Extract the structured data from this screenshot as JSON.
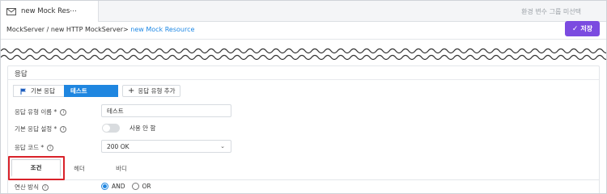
{
  "tab": {
    "title": "new Mock Res⋯",
    "icon": "mail-icon"
  },
  "env_select": {
    "placeholder": "환경 변수 그룹 미선택"
  },
  "breadcrumb": {
    "path": "MockServer / new HTTP MockServer>",
    "active": " new Mock Resource"
  },
  "toolbar": {
    "save_label": "저장"
  },
  "panel": {
    "title": "응답"
  },
  "response_types": {
    "default_label": "기본 응답",
    "current_label": "테스트",
    "add_label": "응답 유형 추가"
  },
  "fields": {
    "type_name": {
      "label": "응답 유형 이름 *",
      "value": "테스트"
    },
    "default_setting": {
      "label": "기본 응답 설정 *",
      "value": "사용 안 함",
      "enabled": false
    },
    "response_code": {
      "label": "응답 코드 *",
      "value": "200 OK"
    }
  },
  "subtabs": [
    "조건",
    "헤더",
    "바디"
  ],
  "operator": {
    "label": "연산 방식",
    "options": [
      "AND",
      "OR"
    ],
    "selected": "AND"
  },
  "colors": {
    "accent": "#7b4be0",
    "primary": "#1f86e0",
    "highlight": "#d9222a"
  }
}
